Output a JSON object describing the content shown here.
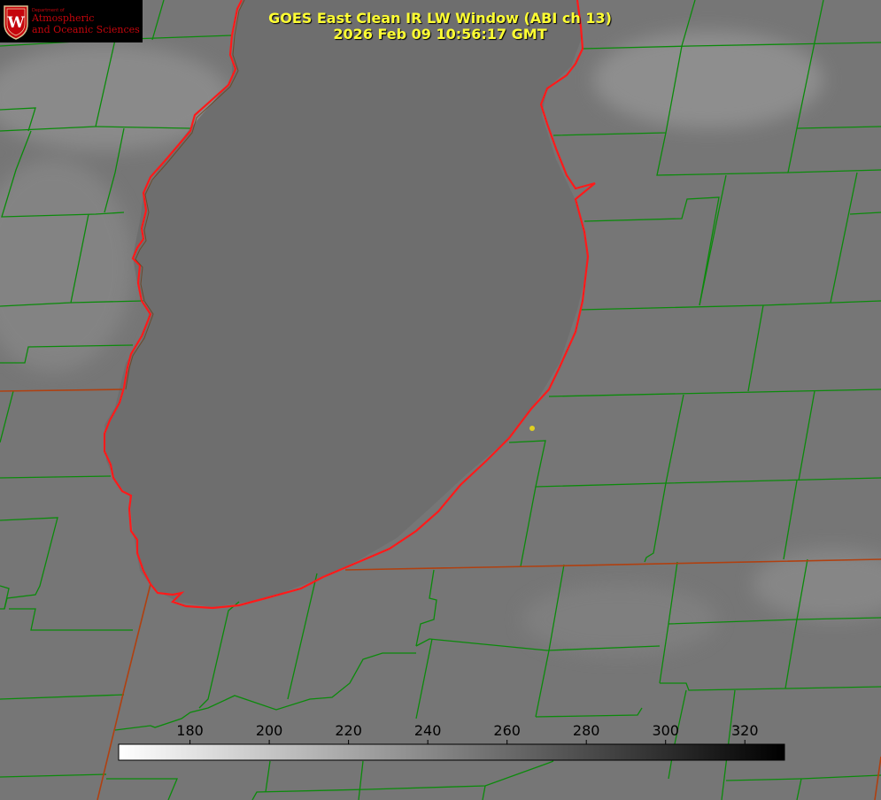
{
  "title": {
    "line1": "GOES East Clean IR LW Window (ABI ch 13)",
    "line2": "2026 Feb 09 10:56:17 GMT"
  },
  "logo": {
    "dept": "Department of",
    "line1": "Atmospheric",
    "line2": "and Oceanic Sciences",
    "seal_letter": "W",
    "color": "#c5050c"
  },
  "colorbar": {
    "ticks": [
      "180",
      "200",
      "220",
      "240",
      "260",
      "280",
      "300",
      "320"
    ],
    "tick_values": [
      180,
      200,
      220,
      240,
      260,
      280,
      300,
      320
    ],
    "range": [
      162,
      330
    ],
    "colors": {
      "low": "#ffffff",
      "high": "#000000"
    }
  },
  "map": {
    "background": "#767676",
    "county_border_color": "#0b8a0b",
    "state_border_color": "#b04010",
    "shoreline_color": "#ff2020",
    "marker_color": "#e0d020"
  }
}
